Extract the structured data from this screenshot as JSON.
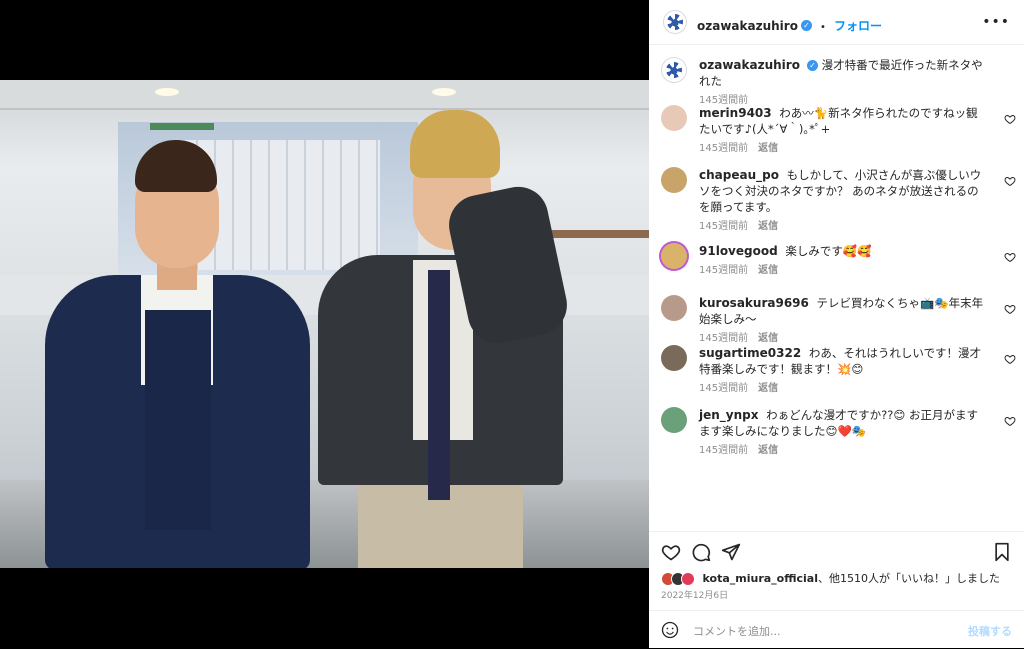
{
  "header": {
    "username": "ozawakazuhiro",
    "dot": "•",
    "follow_label": "フォロー",
    "more": "•••"
  },
  "caption": {
    "username": "ozawakazuhiro",
    "text": "漫才特番で最近作った新ネタやれた",
    "time": "145週間前"
  },
  "comments": [
    {
      "username": "merin9403",
      "text": "わあ〰🐈新ネタ作られたのですねッ観たいです♪(人*´∀｀)｡*ﾟ+",
      "time": "145週間前",
      "reply": "返信",
      "avatar_color": "#e8c9b8"
    },
    {
      "username": "chapeau_po",
      "text": "もしかして、小沢さんが喜ぶ優しいウソをつく対決のネタですか？ あのネタが放送されるのを願ってます。",
      "time": "145週間前",
      "reply": "返信",
      "avatar_color": "#c8a46a"
    },
    {
      "username": "91lovegood",
      "text": "楽しみです🥰🥰",
      "time": "145週間前",
      "reply": "返信",
      "avatar_color": "#d9b36a"
    },
    {
      "username": "kurosakura9696",
      "text": "テレビ買わなくちゃ📺🎭年末年始楽しみ〜",
      "time": "145週間前",
      "reply": "返信",
      "avatar_color": "#b89a8a"
    },
    {
      "username": "sugartime0322",
      "text": "わあ、それはうれしいです！漫才特番楽しみです！観ます！💥😊",
      "time": "145週間前",
      "reply": "返信",
      "avatar_color": "#7a6a5a"
    },
    {
      "username": "jen_ynpx",
      "text": "わぁどんな漫才ですか??😊 お正月がますます楽しみになりました😊❤️🎭",
      "time": "145週間前",
      "reply": "返信",
      "avatar_color": "#6aa07a"
    }
  ],
  "likes": {
    "text_user": "kota_miura_official",
    "text_rest": "、他1510人が「いいね！」しました"
  },
  "date": "2022年12月6日",
  "add_comment": {
    "placeholder": "コメントを追加...",
    "post_label": "投稿する"
  },
  "icons": {
    "header_avatar": "logo-icon",
    "verified": "verified-badge-icon",
    "like": "heart-icon",
    "comment": "comment-icon",
    "share": "share-icon",
    "save": "bookmark-icon",
    "emoji": "emoji-icon"
  }
}
